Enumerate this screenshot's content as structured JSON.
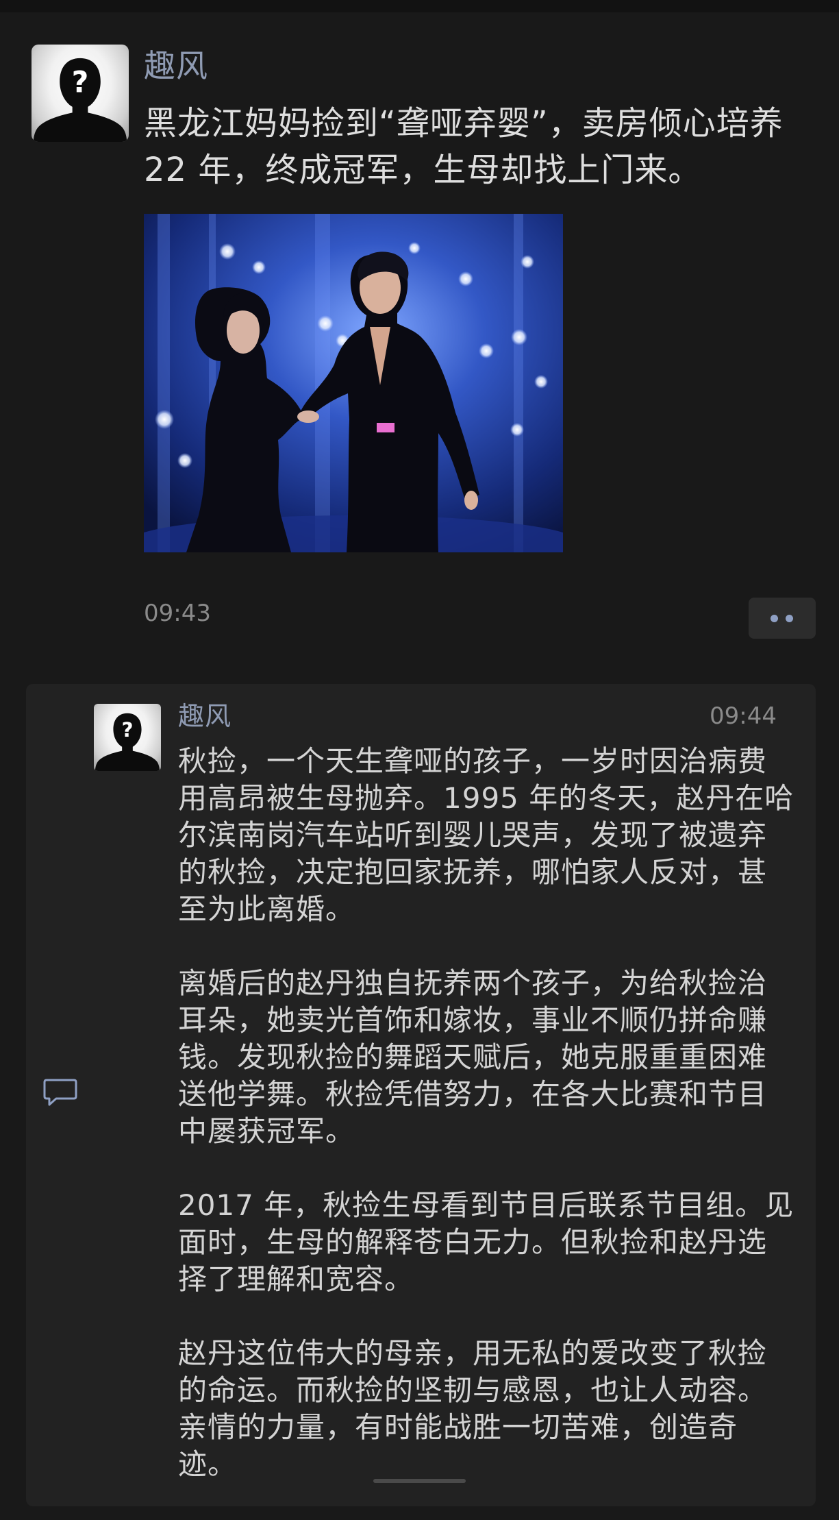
{
  "post": {
    "author": "趣风",
    "text": "黑龙江妈妈捡到“聋哑弃婴”，卖房倾心培养22 年，终成冠军，生母却找上门来。",
    "time": "09:43",
    "image_alt": "dance-performance-photo"
  },
  "comment": {
    "author": "趣风",
    "time": "09:44",
    "paragraphs": [
      "秋捡，一个天生聋哑的孩子，一岁时因治病费用高昂被生母抛弃。1995 年的冬天，赵丹在哈尔滨南岗汽车站听到婴儿哭声，发现了被遗弃的秋捡，决定抱回家抚养，哪怕家人反对，甚至为此离婚。",
      "离婚后的赵丹独自抚养两个孩子，为给秋捡治耳朵，她卖光首饰和嫁妆，事业不顺仍拼命赚钱。发现秋捡的舞蹈天赋后，她克服重重困难送他学舞。秋捡凭借努力，在各大比赛和节目中屡获冠军。",
      "2017 年，秋捡生母看到节目后联系节目组。见面时，生母的解释苍白无力。但秋捡和赵丹选择了理解和宽容。",
      "赵丹这位伟大的母亲，用无私的爱改变了秋捡的命运。而秋捡的坚韧与感恩，也让人动容。亲情的力量，有时能战胜一切苦难，创造奇迹。"
    ]
  },
  "icons": {
    "avatar": "anonymous-silhouette-icon",
    "more": "more-dots-icon",
    "comment": "comment-bubble-icon"
  },
  "colors": {
    "background": "#191919",
    "panel": "#222222",
    "author_link": "#8f9bb3",
    "text": "#d6d6d6",
    "muted": "#8a8a8a",
    "accent_dots": "#8fa0c4"
  }
}
